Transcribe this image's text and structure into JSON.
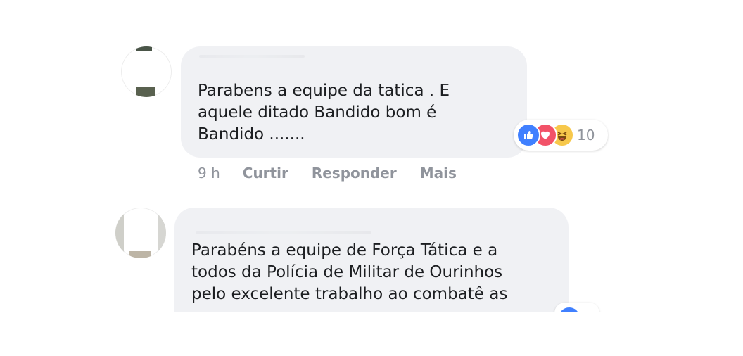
{
  "comments": [
    {
      "text": "Parabens a equipe da tatica . E\naquele ditado Bandido bom é\nBandido .......",
      "time": "9 h",
      "like_label": "Curtir",
      "reply_label": "Responder",
      "more_label": "Mais",
      "reactions": [
        "like-icon",
        "love-icon",
        "haha-icon"
      ],
      "reaction_count": "10"
    },
    {
      "text": "Parabéns a equipe de Força Tática e a\ntodos da Polícia de Militar de Ourinhos\npelo excelente trabalho ao combatê as",
      "reactions": [
        "like-icon"
      ]
    }
  ],
  "colors": {
    "bubble": "#f0f1f4",
    "text": "#1c1e21",
    "meta": "#90949c",
    "like": "#4080ff",
    "love": "#f25268",
    "haha": "#f7c84b"
  }
}
